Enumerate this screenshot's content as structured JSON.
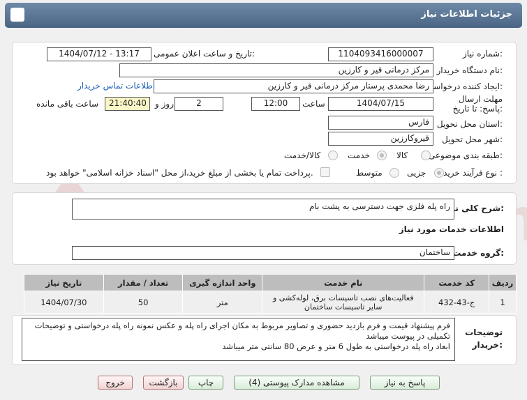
{
  "header": {
    "title": "جزئیات اطلاعات نیاز"
  },
  "form": {
    "need_number_label": "شماره نیاز:",
    "need_number": "1104093416000007",
    "announce_label": "تاریخ و ساعت اعلان عمومی:",
    "announce_value": "1404/07/12 - 13:17",
    "buyer_org_label": "نام دستگاه خریدار:",
    "buyer_org": "مرکز درمانی قیر و کارزین",
    "creator_label": "ایجاد کننده درخواست:",
    "creator": "رضا محمدی پرستار مرکز درمانی قیر و کارزین",
    "contact_link": "اطلاعات تماس خریدار",
    "deadline_label": "مهلت ارسال پاسخ: تا تاریخ:",
    "deadline_date": "1404/07/15",
    "time_label": "ساعت",
    "deadline_time": "12:00",
    "days_value": "2",
    "days_label": "روز و",
    "remaining_time": "21:40:40",
    "remaining_label": "ساعت باقی مانده",
    "province_label": "استان محل تحویل:",
    "province": "فارس",
    "city_label": "شهر محل تحویل:",
    "city": "قیروکارزین",
    "category_label": "طبقه بندی موضوعی:",
    "category_options": [
      "کالا",
      "خدمت",
      "کالا/خدمت"
    ],
    "category_selected": "خدمت",
    "process_label": "نوع فرآیند خرید :",
    "process_options": [
      "جزیی",
      "متوسط"
    ],
    "payment_note": "پرداخت تمام یا بخشی از مبلغ خرید،از محل \"اسناد خزانه اسلامی\" خواهد بود."
  },
  "need": {
    "summary_label": "شرح کلی نیاز:",
    "summary": "راه پله فلزی جهت دسترسی به پشت بام",
    "services_info_label": "اطلاعات خدمات مورد نیاز",
    "service_group_label": "گروه خدمت:",
    "service_group": "ساختمان"
  },
  "table": {
    "headers": [
      "ردیف",
      "کد خدمت",
      "نام خدمت",
      "واحد اندازه گیری",
      "تعداد / مقدار",
      "تاریخ نیاز"
    ],
    "rows": [
      [
        "1",
        "ج-43-432",
        "فعالیت‌های نصب تاسیسات برق، لوله‌کشی و سایر تاسیسات ساختمان",
        "متر",
        "50",
        "1404/07/30"
      ]
    ]
  },
  "notes": {
    "label_line1": "توضیحات",
    "label_line2": "خریدار:",
    "line1": "فرم پیشنهاد قیمت و فرم بازدید حضوری و تصاویر مربوط به مکان اجرای راه پله و عکس نمونه راه پله درخواستی و توضیحات",
    "line2": "تکمیلی در پیوست میباشد",
    "line3": "ابعاد راه پله درخواستی به طول 6 متر و عرض 80 سانتی متر میباشد"
  },
  "buttons": {
    "reply": "پاسخ به نیاز",
    "attachments": "مشاهده مدارک پیوستی (4)",
    "print": "چاپ",
    "back": "بازگشت",
    "exit": "خروج"
  },
  "watermark": {
    "text": "AriaTender.net",
    "color": "#e8c8c8"
  }
}
